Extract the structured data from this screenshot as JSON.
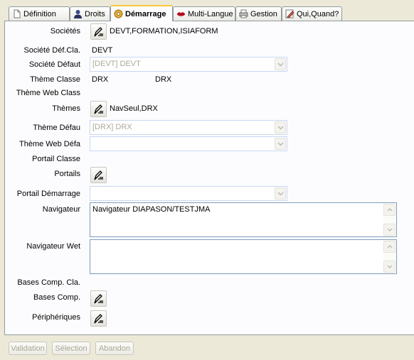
{
  "tabs": [
    {
      "label": "Définition",
      "icon": "page-icon"
    },
    {
      "label": "Droits",
      "icon": "user-icon"
    },
    {
      "label": "Démarrage",
      "icon": "gear-icon"
    },
    {
      "label": "Multi-Langue",
      "icon": "lips-icon"
    },
    {
      "label": "Gestion",
      "icon": "printer-icon"
    },
    {
      "label": "Qui,Quand?",
      "icon": "edit-icon"
    }
  ],
  "active_tab": "Démarrage",
  "form": {
    "societes": {
      "label": "Sociétés",
      "value": "DEVT,FORMATION,ISIAFORM"
    },
    "societe_def_cla": {
      "label": "Société Déf.Cla.",
      "value": "DEVT"
    },
    "societe_defaut": {
      "label": "Société Défaut",
      "value": "[DEVT] DEVT"
    },
    "theme_classe": {
      "label": "Thème Classe",
      "value1": "DRX",
      "value2": "DRX"
    },
    "theme_web_classe": {
      "label": "Thème Web Class",
      "value": ""
    },
    "themes": {
      "label": "Thèmes",
      "value": "NavSeul,DRX"
    },
    "theme_defaut": {
      "label": "Thème Défau",
      "value": "[DRX] DRX"
    },
    "theme_web_defaut": {
      "label": "Thème Web Défa",
      "value": ""
    },
    "portail_classe": {
      "label": "Portail  Classe",
      "value": ""
    },
    "portails": {
      "label": "Portails",
      "value": ""
    },
    "portail_demarrage": {
      "label": "Portail Démarrage",
      "value": ""
    },
    "navigateur": {
      "label": "Navigateur",
      "value": "Navigateur DIAPASON/TESTJMA"
    },
    "navigateur_web": {
      "label": "Navigateur Wet",
      "value": ""
    },
    "bases_comp_cla": {
      "label": "Bases Comp. Cla.",
      "value": ""
    },
    "bases_comp": {
      "label": "Bases Comp.",
      "value": ""
    },
    "peripheriques": {
      "label": "Périphériques",
      "value": ""
    }
  },
  "buttons": {
    "validation": "Validation",
    "selection": "Sélection",
    "abandon": "Abandon"
  },
  "colors": {
    "background": "#ECE9D8",
    "panel": "#FCFCFE",
    "active_tab_accent": "#FFC83C",
    "disabled_text": "#ACA899"
  }
}
